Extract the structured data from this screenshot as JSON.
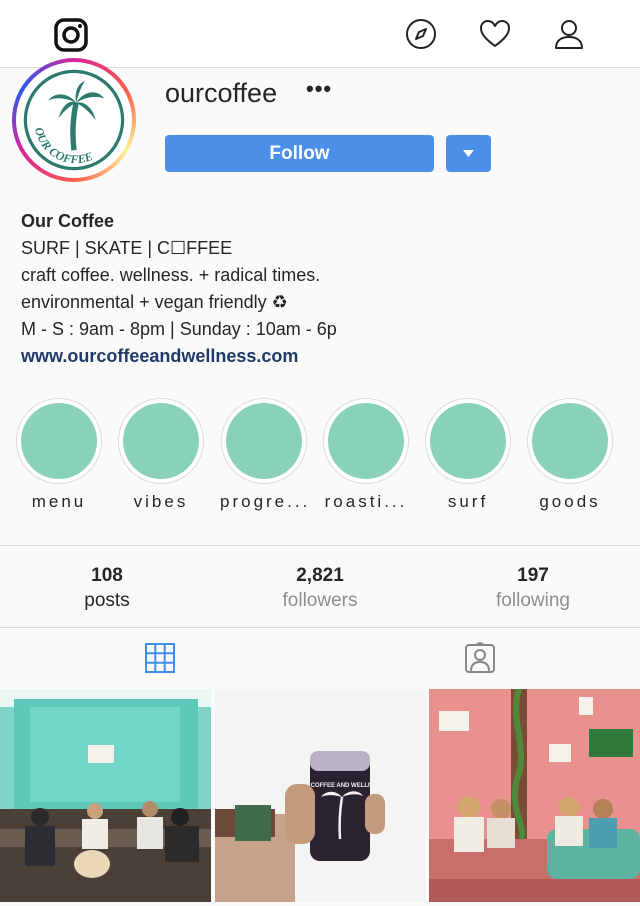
{
  "app": {
    "name": "Instagram"
  },
  "icons": {
    "logo": "instagram-logo-icon",
    "explore": "compass-icon",
    "activity": "heart-icon",
    "profile": "user-icon",
    "grid_tab": "grid-icon",
    "tagged_tab": "tagged-person-icon",
    "dropdown": "triangle-down-icon"
  },
  "profile": {
    "username": "ourcoffee",
    "more": "•••",
    "avatar_text": "OUR COFFEE",
    "follow_label": "Follow",
    "bio": {
      "name": "Our Coffee",
      "lines": [
        "SURF | SKATE | C☐FFEE",
        "craft coffee. wellness. + radical times.",
        "environmental + vegan friendly ♻",
        "M - S : 9am - 8pm | Sunday : 10am - 6p"
      ],
      "link": "www.ourcoffeeandwellness.com"
    }
  },
  "highlights": [
    {
      "label": "menu"
    },
    {
      "label": "vibes"
    },
    {
      "label": "progre..."
    },
    {
      "label": "roasti..."
    },
    {
      "label": "surf"
    },
    {
      "label": "goods"
    }
  ],
  "stats": {
    "posts": {
      "value": "108",
      "label": "posts"
    },
    "followers": {
      "value": "2,821",
      "label": "followers"
    },
    "following": {
      "value": "197",
      "label": "following"
    }
  },
  "posts": {
    "tile1_caption": "",
    "tile2_can_text": "OUR COFFEE AND WELLNESS"
  },
  "colors": {
    "accent": "#4b8fe9",
    "highlight_fill": "#89d1b8",
    "link": "#1f3a68",
    "muted": "#8e8e8e",
    "border": "#dbdbdb"
  }
}
